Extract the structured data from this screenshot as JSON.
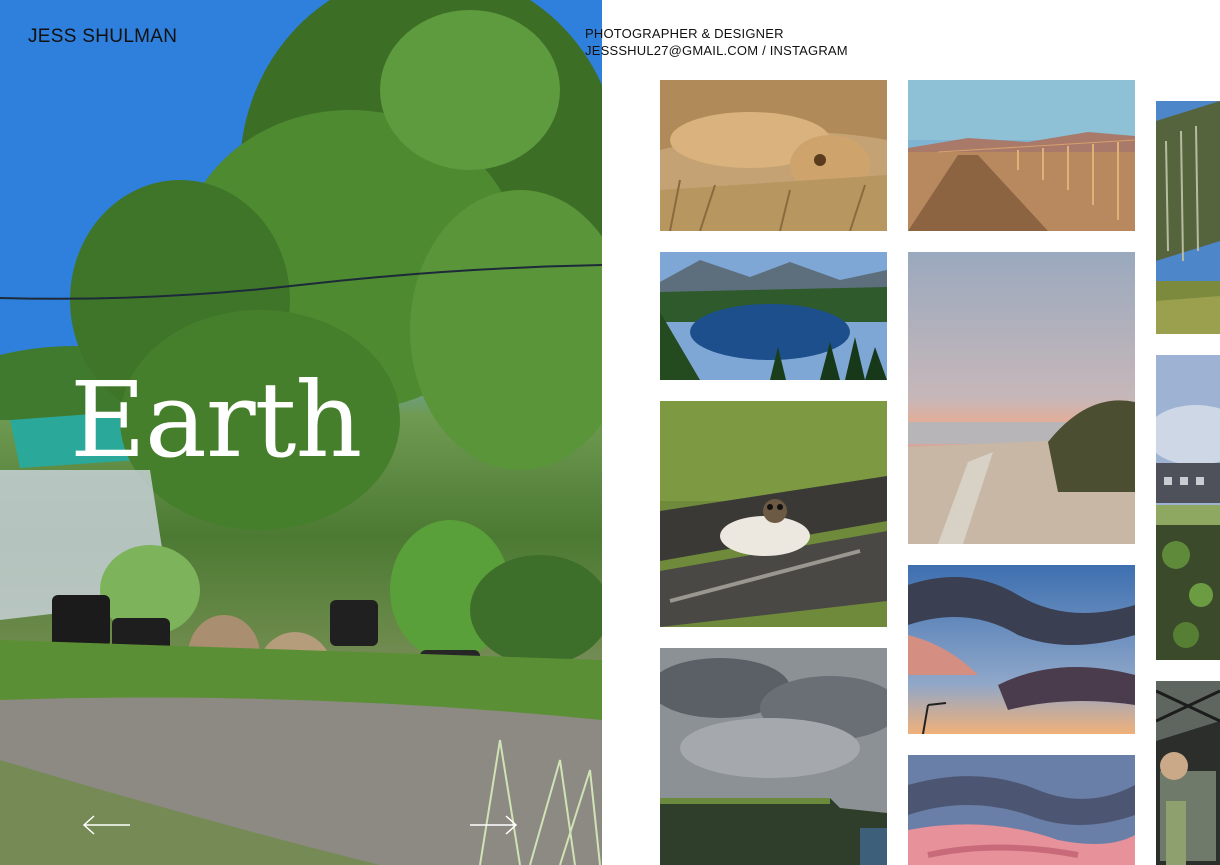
{
  "site": {
    "name": "JESS SHULMAN",
    "role": "PHOTOGRAPHER & DESIGNER",
    "email": "JESSSHUL27@GMAIL.COM",
    "separator": "/",
    "instagram": "INSTAGRAM"
  },
  "hero": {
    "title": "Earth",
    "prev_icon": "arrow-left-icon",
    "next_icon": "arrow-right-icon"
  },
  "gallery": {
    "photos": [
      {
        "subject": "lion-lying-in-grass"
      },
      {
        "subject": "desert-fence-road"
      },
      {
        "subject": "mossy-tree"
      },
      {
        "subject": "mountain-lake"
      },
      {
        "subject": "sunset-beach-driftwood"
      },
      {
        "subject": "cloudy-sky-house"
      },
      {
        "subject": "jumping-spider"
      },
      {
        "subject": "garden-beds"
      },
      {
        "subject": "cliffs-overcast"
      },
      {
        "subject": "sunset-clouds-streetlight"
      },
      {
        "subject": "greenhouse-interior"
      },
      {
        "subject": "pink-clouds"
      }
    ]
  }
}
